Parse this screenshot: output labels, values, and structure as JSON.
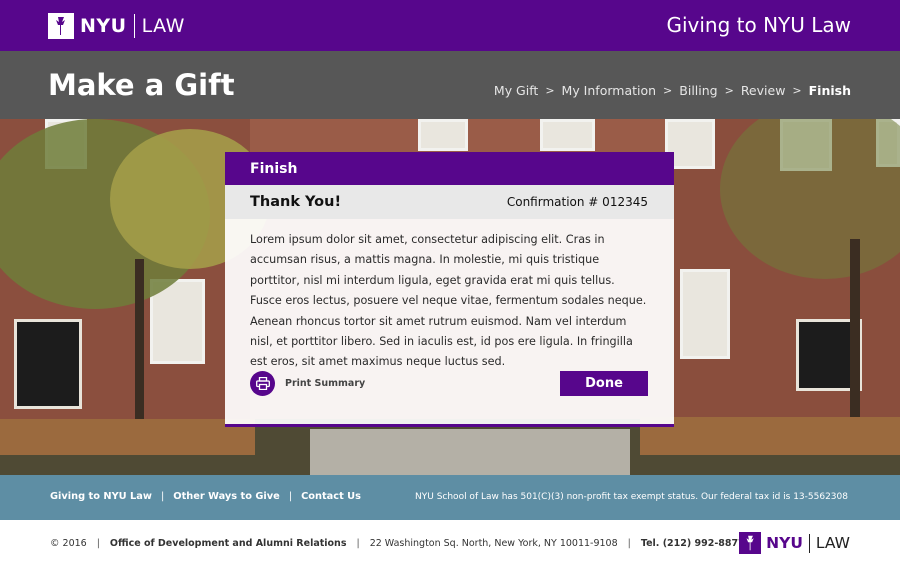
{
  "header": {
    "logo_nyu": "NYU",
    "logo_law": "LAW",
    "site_title": "Giving to NYU Law"
  },
  "titlebar": {
    "page_title": "Make a Gift",
    "breadcrumb": [
      "My Gift",
      "My Information",
      "Billing",
      "Review",
      "Finish"
    ],
    "breadcrumb_separator": ">",
    "active_step": "Finish"
  },
  "card": {
    "heading": "Finish",
    "thanks": "Thank You!",
    "confirmation": "Confirmation # 012345",
    "body": "Lorem ipsum dolor sit amet, consectetur adipiscing elit. Cras in accumsan risus, a mattis magna. In molestie, mi quis tristique porttitor, nisl mi interdum ligula, eget gravida erat mi quis tellus. Fusce eros lectus, posuere vel neque vitae, fermentum sodales neque. Aenean rhoncus tortor sit amet rutrum euismod. Nam vel interdum nisl, et porttitor libero. Sed in iaculis est, id pos ere ligula. In fringilla est eros, sit amet maximus neque luctus sed.",
    "print_label": "Print Summary",
    "done_label": "Done"
  },
  "footer": {
    "links": [
      "Giving to NYU Law",
      "Other Ways to Give",
      "Contact Us"
    ],
    "tax_note": "NYU School of Law has 501(C)(3) non-profit tax exempt status. Our federal tax id is 13-5562308",
    "copyright": "© 2016",
    "office": "Office of Development and Alumni Relations",
    "address": "22 Washington Sq. North, New York, NY 10011-9108",
    "phone": "Tel. (212) 992-8877",
    "logo_nyu": "NYU",
    "logo_law": "LAW"
  },
  "colors": {
    "brand_purple": "#57068c",
    "title_gray": "#575757",
    "footer_blue": "#5e8ea4"
  }
}
